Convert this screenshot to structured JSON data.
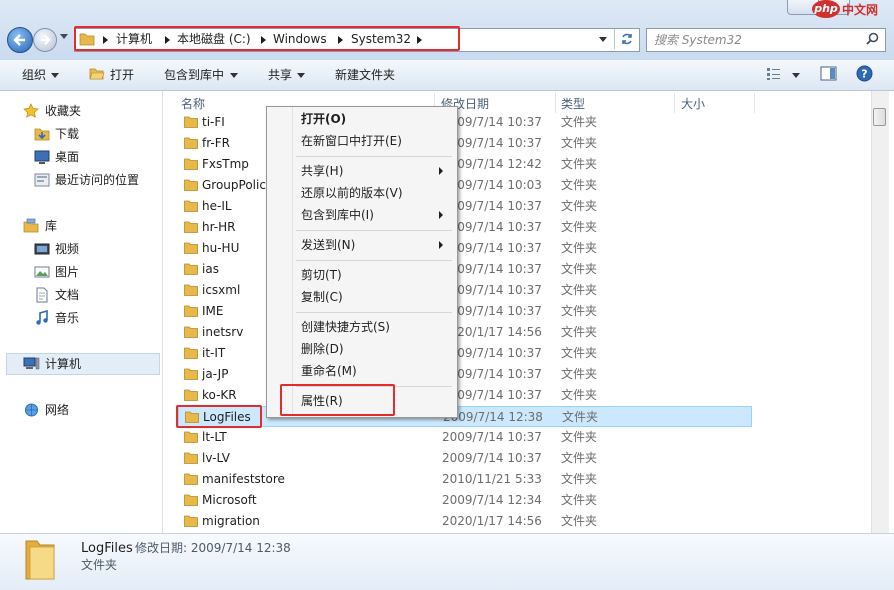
{
  "address": {
    "crumbs": [
      "计算机",
      "本地磁盘 (C:)",
      "Windows",
      "System32"
    ],
    "search_placeholder": "搜索 System32"
  },
  "toolbar": {
    "organize": "组织",
    "open": "打开",
    "include_in_library": "包含到库中",
    "share": "共享",
    "new_folder": "新建文件夹"
  },
  "sidebar": {
    "favorites": "收藏夹",
    "downloads": "下载",
    "desktop": "桌面",
    "recent": "最近访问的位置",
    "libraries": "库",
    "videos": "视频",
    "pictures": "图片",
    "documents": "文档",
    "music": "音乐",
    "computer": "计算机",
    "network": "网络"
  },
  "columns": {
    "name": "名称",
    "date": "修改日期",
    "type": "类型",
    "size": "大小"
  },
  "files": [
    {
      "name": "ti-FI",
      "date": "2009/7/14 10:37",
      "type": "文件夹"
    },
    {
      "name": "fr-FR",
      "date": "2009/7/14 10:37",
      "type": "文件夹"
    },
    {
      "name": "FxsTmp",
      "date": "2009/7/14 12:42",
      "type": "文件夹"
    },
    {
      "name": "GroupPolicy",
      "date": "2009/7/14 10:03",
      "type": "文件夹"
    },
    {
      "name": "he-IL",
      "date": "2009/7/14 10:37",
      "type": "文件夹"
    },
    {
      "name": "hr-HR",
      "date": "2009/7/14 10:37",
      "type": "文件夹"
    },
    {
      "name": "hu-HU",
      "date": "2009/7/14 10:37",
      "type": "文件夹"
    },
    {
      "name": "ias",
      "date": "2009/7/14 10:37",
      "type": "文件夹"
    },
    {
      "name": "icsxml",
      "date": "2009/7/14 10:37",
      "type": "文件夹"
    },
    {
      "name": "IME",
      "date": "2009/7/14 10:37",
      "type": "文件夹"
    },
    {
      "name": "inetsrv",
      "date": "2020/1/17 14:56",
      "type": "文件夹"
    },
    {
      "name": "it-IT",
      "date": "2009/7/14 10:37",
      "type": "文件夹"
    },
    {
      "name": "ja-JP",
      "date": "2009/7/14 10:37",
      "type": "文件夹"
    },
    {
      "name": "ko-KR",
      "date": "2009/7/14 10:37",
      "type": "文件夹"
    },
    {
      "name": "LogFiles",
      "date": "2009/7/14 12:38",
      "type": "文件夹"
    },
    {
      "name": "lt-LT",
      "date": "2009/7/14 10:37",
      "type": "文件夹"
    },
    {
      "name": "lv-LV",
      "date": "2009/7/14 10:37",
      "type": "文件夹"
    },
    {
      "name": "manifeststore",
      "date": "2010/11/21 5:33",
      "type": "文件夹"
    },
    {
      "name": "Microsoft",
      "date": "2009/7/14 12:34",
      "type": "文件夹"
    },
    {
      "name": "migration",
      "date": "2020/1/17 14:56",
      "type": "文件夹"
    }
  ],
  "context_menu": {
    "open": "打开(O)",
    "open_new_window": "在新窗口中打开(E)",
    "share": "共享(H)",
    "restore_previous": "还原以前的版本(V)",
    "include_in_library": "包含到库中(I)",
    "send_to": "发送到(N)",
    "cut": "剪切(T)",
    "copy": "复制(C)",
    "create_shortcut": "创建快捷方式(S)",
    "delete": "删除(D)",
    "rename": "重命名(M)",
    "properties": "属性(R)"
  },
  "details": {
    "name": "LogFiles",
    "modified": "修改日期: 2009/7/14 12:38",
    "type": "文件夹"
  },
  "watermark": {
    "logo": "php",
    "text": "中文网"
  },
  "colors": {
    "highlight": "#e12d2d",
    "selection": "#cce8ff",
    "folder": "#e8b94a"
  }
}
